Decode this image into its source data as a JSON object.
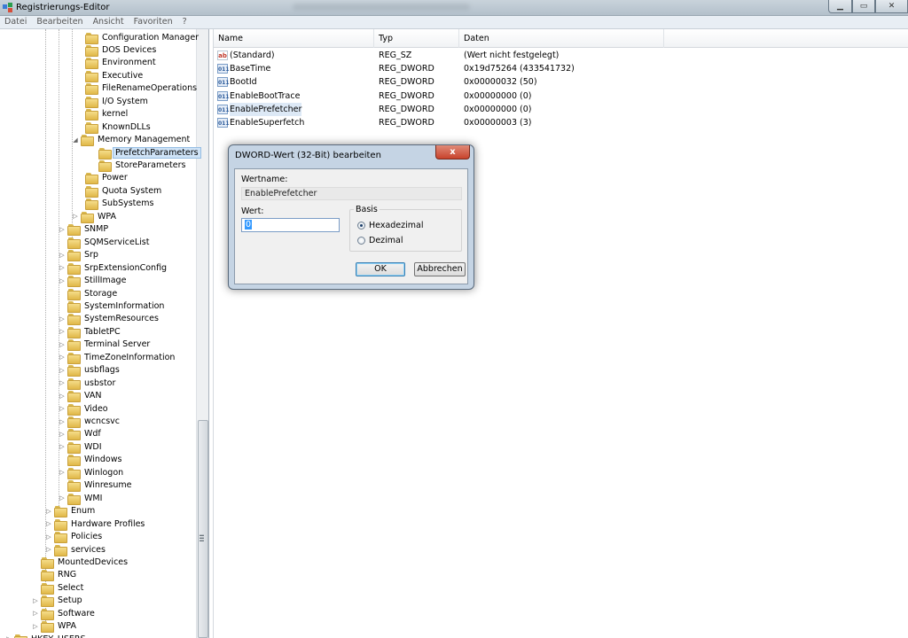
{
  "window": {
    "title": "Registrierungs-Editor",
    "icon": "regedit-icon"
  },
  "menu": [
    "Datei",
    "Bearbeiten",
    "Ansicht",
    "Favoriten",
    "?"
  ],
  "tree": [
    {
      "label": "Configuration Manager",
      "exp": ""
    },
    {
      "label": "DOS Devices",
      "exp": ""
    },
    {
      "label": "Environment",
      "exp": ""
    },
    {
      "label": "Executive",
      "exp": ""
    },
    {
      "label": "FileRenameOperations",
      "exp": ""
    },
    {
      "label": "I/O System",
      "exp": ""
    },
    {
      "label": "kernel",
      "exp": ""
    },
    {
      "label": "KnownDLLs",
      "exp": ""
    },
    {
      "label": "Memory Management",
      "exp": "◢"
    },
    {
      "label": "PrefetchParameters",
      "exp": ""
    },
    {
      "label": "StoreParameters",
      "exp": ""
    },
    {
      "label": "Power",
      "exp": ""
    },
    {
      "label": "Quota System",
      "exp": ""
    },
    {
      "label": "SubSystems",
      "exp": ""
    },
    {
      "label": "WPA",
      "exp": "▷"
    },
    {
      "label": "SNMP",
      "exp": "▷"
    },
    {
      "label": "SQMServiceList",
      "exp": ""
    },
    {
      "label": "Srp",
      "exp": "▷"
    },
    {
      "label": "SrpExtensionConfig",
      "exp": "▷"
    },
    {
      "label": "StillImage",
      "exp": "▷"
    },
    {
      "label": "Storage",
      "exp": ""
    },
    {
      "label": "SystemInformation",
      "exp": ""
    },
    {
      "label": "SystemResources",
      "exp": "▷"
    },
    {
      "label": "TabletPC",
      "exp": "▷"
    },
    {
      "label": "Terminal Server",
      "exp": "▷"
    },
    {
      "label": "TimeZoneInformation",
      "exp": "▷"
    },
    {
      "label": "usbflags",
      "exp": "▷"
    },
    {
      "label": "usbstor",
      "exp": "▷"
    },
    {
      "label": "VAN",
      "exp": "▷"
    },
    {
      "label": "Video",
      "exp": "▷"
    },
    {
      "label": "wcncsvc",
      "exp": "▷"
    },
    {
      "label": "Wdf",
      "exp": "▷"
    },
    {
      "label": "WDI",
      "exp": "▷"
    },
    {
      "label": "Windows",
      "exp": ""
    },
    {
      "label": "Winlogon",
      "exp": "▷"
    },
    {
      "label": "Winresume",
      "exp": ""
    },
    {
      "label": "WMI",
      "exp": "▷"
    },
    {
      "label": "Enum",
      "exp": "▷"
    },
    {
      "label": "Hardware Profiles",
      "exp": "▷"
    },
    {
      "label": "Policies",
      "exp": "▷"
    },
    {
      "label": "services",
      "exp": "▷"
    },
    {
      "label": "MountedDevices",
      "exp": ""
    },
    {
      "label": "RNG",
      "exp": ""
    },
    {
      "label": "Select",
      "exp": ""
    },
    {
      "label": "Setup",
      "exp": "▷"
    },
    {
      "label": "Software",
      "exp": "▷"
    },
    {
      "label": "WPA",
      "exp": "▷"
    },
    {
      "label": "HKEY_USERS",
      "exp": "▷"
    }
  ],
  "list": {
    "columns": [
      "Name",
      "Typ",
      "Daten"
    ],
    "rows": [
      {
        "name": "(Standard)",
        "type": "REG_SZ",
        "data": "(Wert nicht festgelegt)",
        "icon": "ab"
      },
      {
        "name": "BaseTime",
        "type": "REG_DWORD",
        "data": "0x19d75264 (433541732)",
        "icon": "011"
      },
      {
        "name": "BootId",
        "type": "REG_DWORD",
        "data": "0x00000032 (50)",
        "icon": "011"
      },
      {
        "name": "EnableBootTrace",
        "type": "REG_DWORD",
        "data": "0x00000000 (0)",
        "icon": "011"
      },
      {
        "name": "EnablePrefetcher",
        "type": "REG_DWORD",
        "data": "0x00000000 (0)",
        "icon": "011"
      },
      {
        "name": "EnableSuperfetch",
        "type": "REG_DWORD",
        "data": "0x00000003 (3)",
        "icon": "011"
      }
    ]
  },
  "dialog": {
    "title": "DWORD-Wert (32-Bit) bearbeiten",
    "close": "x",
    "value_name_label": "Wertname:",
    "value_name": "EnablePrefetcher",
    "value_label": "Wert:",
    "value": "0",
    "base_label": "Basis",
    "hex_label": "Hexadezimal",
    "dec_label": "Dezimal",
    "ok": "OK",
    "cancel": "Abbrechen",
    "hex_selected": true
  }
}
